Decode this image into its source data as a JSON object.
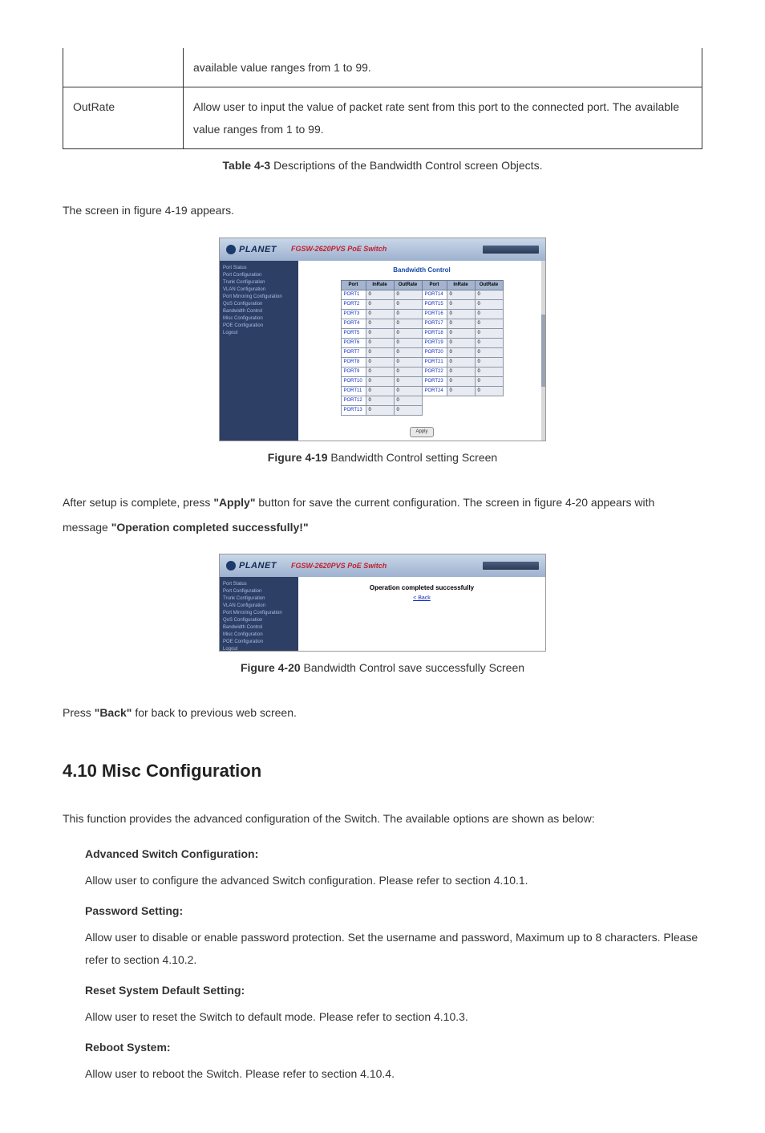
{
  "table_rows": [
    {
      "label": "",
      "desc": "available value ranges from 1 to 99."
    },
    {
      "label": "OutRate",
      "desc": "Allow user to input the value of packet rate sent from this port to the connected port. The available value ranges from 1 to 99."
    }
  ],
  "table_caption_bold": "Table 4-3",
  "table_caption_text": " Descriptions of the Bandwidth Control screen Objects.",
  "para_before_fig19": "The screen in figure 4-19 appears.",
  "device_header": {
    "brand": "PLANET",
    "model": "FGSW-2620PVS PoE Switch"
  },
  "sidebar_items": [
    "Port Status",
    "Port Configuration",
    "Trunk Configuration",
    "VLAN Configuration",
    "Port Mirroring Configuration",
    "QoS Configuration",
    "Bandwidth Control",
    "Misc Configuration",
    "POE Configuration",
    "Logout"
  ],
  "bw_title": "Bandwidth Control",
  "bw_headers": [
    "Port",
    "InRate",
    "OutRate",
    "Port",
    "InRate",
    "OutRate"
  ],
  "chart_data": {
    "type": "table",
    "title": "Bandwidth Control",
    "columns": [
      "Port",
      "InRate",
      "OutRate"
    ],
    "rows": [
      {
        "Port": "PORT1",
        "InRate": 0,
        "OutRate": 0
      },
      {
        "Port": "PORT2",
        "InRate": 0,
        "OutRate": 0
      },
      {
        "Port": "PORT3",
        "InRate": 0,
        "OutRate": 0
      },
      {
        "Port": "PORT4",
        "InRate": 0,
        "OutRate": 0
      },
      {
        "Port": "PORT5",
        "InRate": 0,
        "OutRate": 0
      },
      {
        "Port": "PORT6",
        "InRate": 0,
        "OutRate": 0
      },
      {
        "Port": "PORT7",
        "InRate": 0,
        "OutRate": 0
      },
      {
        "Port": "PORT8",
        "InRate": 0,
        "OutRate": 0
      },
      {
        "Port": "PORT9",
        "InRate": 0,
        "OutRate": 0
      },
      {
        "Port": "PORT10",
        "InRate": 0,
        "OutRate": 0
      },
      {
        "Port": "PORT11",
        "InRate": 0,
        "OutRate": 0
      },
      {
        "Port": "PORT12",
        "InRate": 0,
        "OutRate": 0
      },
      {
        "Port": "PORT13",
        "InRate": 0,
        "OutRate": 0
      },
      {
        "Port": "PORT14",
        "InRate": 0,
        "OutRate": 0
      },
      {
        "Port": "PORT15",
        "InRate": 0,
        "OutRate": 0
      },
      {
        "Port": "PORT16",
        "InRate": 0,
        "OutRate": 0
      },
      {
        "Port": "PORT17",
        "InRate": 0,
        "OutRate": 0
      },
      {
        "Port": "PORT18",
        "InRate": 0,
        "OutRate": 0
      },
      {
        "Port": "PORT19",
        "InRate": 0,
        "OutRate": 0
      },
      {
        "Port": "PORT20",
        "InRate": 0,
        "OutRate": 0
      },
      {
        "Port": "PORT21",
        "InRate": 0,
        "OutRate": 0
      },
      {
        "Port": "PORT22",
        "InRate": 0,
        "OutRate": 0
      },
      {
        "Port": "PORT23",
        "InRate": 0,
        "OutRate": 0
      },
      {
        "Port": "PORT24",
        "InRate": 0,
        "OutRate": 0
      }
    ]
  },
  "bw_rows": [
    [
      "PORT1",
      "0",
      "0",
      "PORT14",
      "0",
      "0"
    ],
    [
      "PORT2",
      "0",
      "0",
      "PORT15",
      "0",
      "0"
    ],
    [
      "PORT3",
      "0",
      "0",
      "PORT16",
      "0",
      "0"
    ],
    [
      "PORT4",
      "0",
      "0",
      "PORT17",
      "0",
      "0"
    ],
    [
      "PORT5",
      "0",
      "0",
      "PORT18",
      "0",
      "0"
    ],
    [
      "PORT6",
      "0",
      "0",
      "PORT19",
      "0",
      "0"
    ],
    [
      "PORT7",
      "0",
      "0",
      "PORT20",
      "0",
      "0"
    ],
    [
      "PORT8",
      "0",
      "0",
      "PORT21",
      "0",
      "0"
    ],
    [
      "PORT9",
      "0",
      "0",
      "PORT22",
      "0",
      "0"
    ],
    [
      "PORT10",
      "0",
      "0",
      "PORT23",
      "0",
      "0"
    ],
    [
      "PORT11",
      "0",
      "0",
      "PORT24",
      "0",
      "0"
    ],
    [
      "PORT12",
      "0",
      "0",
      "",
      "",
      ""
    ],
    [
      "PORT13",
      "0",
      "0",
      "",
      "",
      ""
    ]
  ],
  "apply_label": "Apply",
  "fig19_caption_bold": "Figure 4-19",
  "fig19_caption_text": " Bandwidth Control setting Screen",
  "para_after_fig19_part1": "After setup is complete, press ",
  "para_after_fig19_bold1": "\"Apply\"",
  "para_after_fig19_part2": " button for save the current configuration. The screen in figure 4-20 appears with message ",
  "para_after_fig19_bold2": "\"Operation completed successfully!\"",
  "success_message": "Operation completed successfully",
  "back_link": "< Back",
  "fig20_caption_bold": "Figure 4-20",
  "fig20_caption_text": " Bandwidth Control save successfully Screen",
  "para_before_410_part1": "Press ",
  "para_before_410_bold": "\"Back\"",
  "para_before_410_part2": " for back to previous web screen.",
  "section_heading": "4.10 Misc Configuration",
  "section_intro": "This function provides the advanced configuration of the Switch. The available options are shown as below:",
  "misc": [
    {
      "label": "Advanced Switch Configuration:",
      "desc": "Allow user to configure the advanced Switch configuration. Please refer to section 4.10.1."
    },
    {
      "label": "Password Setting:",
      "desc": "Allow user to disable or enable password protection. Set the username and password, Maximum up to 8 characters. Please refer to section 4.10.2."
    },
    {
      "label": "Reset System Default Setting:",
      "desc": "Allow user to reset the Switch to default mode. Please refer to section 4.10.3."
    },
    {
      "label": "Reboot System:",
      "desc": "Allow user to reboot the Switch. Please refer to section 4.10.4."
    }
  ]
}
